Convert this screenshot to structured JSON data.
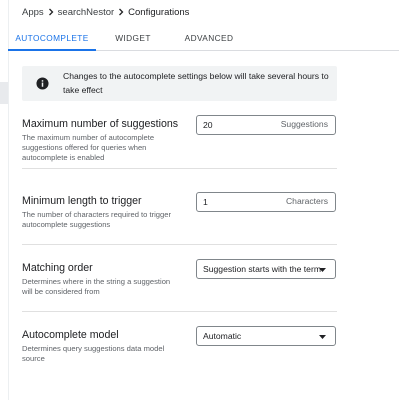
{
  "breadcrumb": {
    "items": [
      "Apps",
      "searchNestor",
      "Configurations"
    ]
  },
  "tabs": [
    {
      "label": "AUTOCOMPLETE",
      "active": true
    },
    {
      "label": "WIDGET",
      "active": false
    },
    {
      "label": "ADVANCED",
      "active": false
    }
  ],
  "banner": {
    "text": "Changes to the autocomplete settings below will take several hours to take effect"
  },
  "settings": {
    "max_suggestions": {
      "title": "Maximum number of suggestions",
      "description": "The maximum number of autocomplete suggestions offered for queries when autocomplete is enabled",
      "value": "20",
      "suffix": "Suggestions"
    },
    "min_length": {
      "title": "Minimum length to trigger",
      "description": "The number of characters required to trigger autocomplete suggestions",
      "value": "1",
      "suffix": "Characters"
    },
    "matching_order": {
      "title": "Matching order",
      "description": "Determines where in the string a suggestion will be considered from",
      "selected": "Suggestion starts with the term"
    },
    "model": {
      "title": "Autocomplete model",
      "description": "Determines query suggestions data model source",
      "selected": "Automatic"
    }
  },
  "colors": {
    "accent": "#1a73e8",
    "text": "#202124",
    "muted": "#5f6368",
    "banner_bg": "#f1f3f4"
  }
}
